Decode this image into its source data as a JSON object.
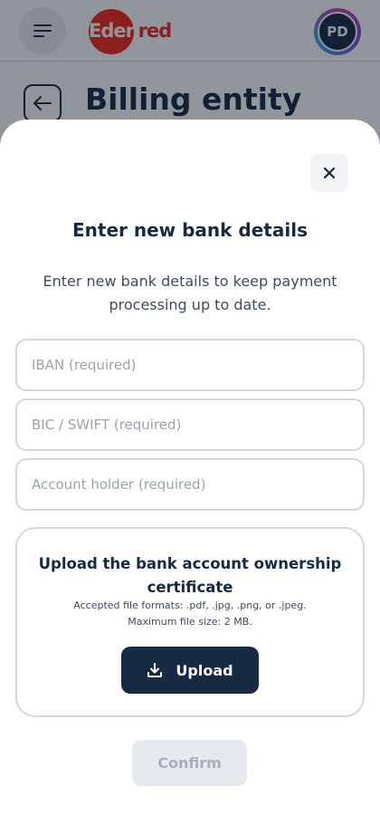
{
  "header": {
    "menu_icon": "hamburger-menu-icon",
    "logo_text_prefix": "Eden",
    "logo_text_suffix": "red",
    "avatar_initials": "PD",
    "brand_color": "#f72717"
  },
  "page": {
    "title": "Billing entity",
    "back_icon": "arrow-left-icon"
  },
  "modal": {
    "close_icon": "close-icon",
    "title": "Enter new bank details",
    "description": "Enter new bank details to keep payment processing up to date.",
    "fields": {
      "iban_placeholder": "IBAN (required)",
      "bic_placeholder": "BIC / SWIFT (required)",
      "holder_placeholder": "Account holder (required)"
    },
    "upload": {
      "title": "Upload the bank account ownership certificate",
      "formats": "Accepted file formats: .pdf, .jpg, .png, or .jpeg.",
      "max_size": "Maximum file size: 2 MB.",
      "button_label": "Upload",
      "button_icon": "download-icon"
    },
    "confirm_label": "Confirm"
  },
  "colors": {
    "primary_dark": "#162a43",
    "disabled_bg": "#e6e9ed",
    "disabled_text": "#a6afba"
  }
}
